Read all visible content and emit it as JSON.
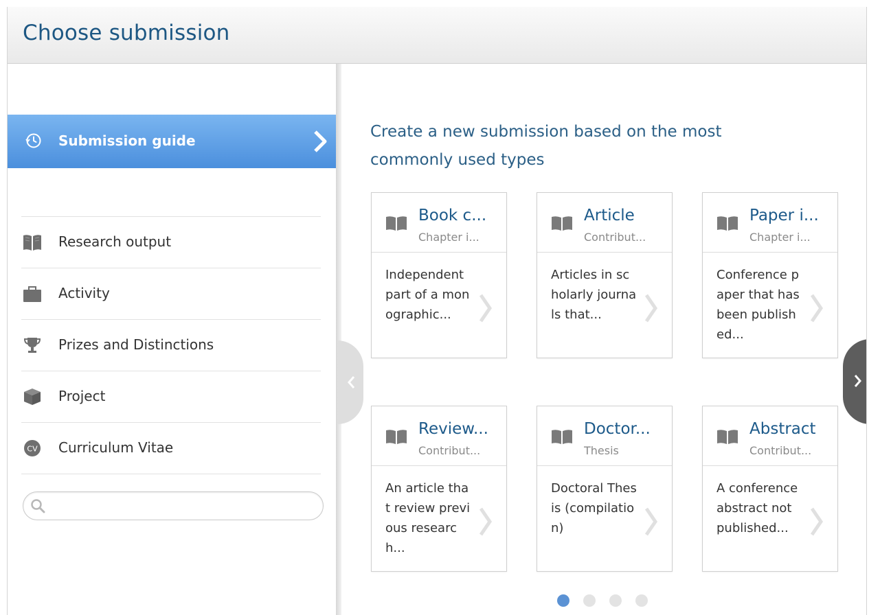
{
  "header": {
    "title": "Choose submission"
  },
  "sidebar": {
    "guide_label": "Submission guide",
    "items": [
      {
        "label": "Research output",
        "icon": "book-icon"
      },
      {
        "label": "Activity",
        "icon": "briefcase-icon"
      },
      {
        "label": "Prizes and Distinctions",
        "icon": "trophy-icon"
      },
      {
        "label": "Project",
        "icon": "cube-icon"
      },
      {
        "label": "Curriculum Vitae",
        "icon": "cv-icon"
      }
    ],
    "search": {
      "value": "",
      "placeholder": ""
    }
  },
  "main": {
    "intro": "Create a new submission based on the most commonly used types",
    "cards": [
      {
        "title": "Book c...",
        "subtitle": "Chapter i...",
        "desc": "Independent part of a monographic..."
      },
      {
        "title": "Article",
        "subtitle": "Contribut...",
        "desc": "Articles in scholarly journals that..."
      },
      {
        "title": "Paper i...",
        "subtitle": "Chapter i...",
        "desc": "Conference paper that has been published..."
      },
      {
        "title": "Review...",
        "subtitle": "Contribut...",
        "desc": "An article that review previous research..."
      },
      {
        "title": "Doctor...",
        "subtitle": "Thesis",
        "desc": "Doctoral Thesis (compilation)"
      },
      {
        "title": "Abstract",
        "subtitle": "Contribut...",
        "desc": "A conference abstract not published..."
      }
    ],
    "pagination": {
      "pages": 4,
      "current": 1
    }
  },
  "colors": {
    "accent": "#4b8fdd",
    "title": "#1d5783",
    "active_dot": "#5b92d4"
  }
}
